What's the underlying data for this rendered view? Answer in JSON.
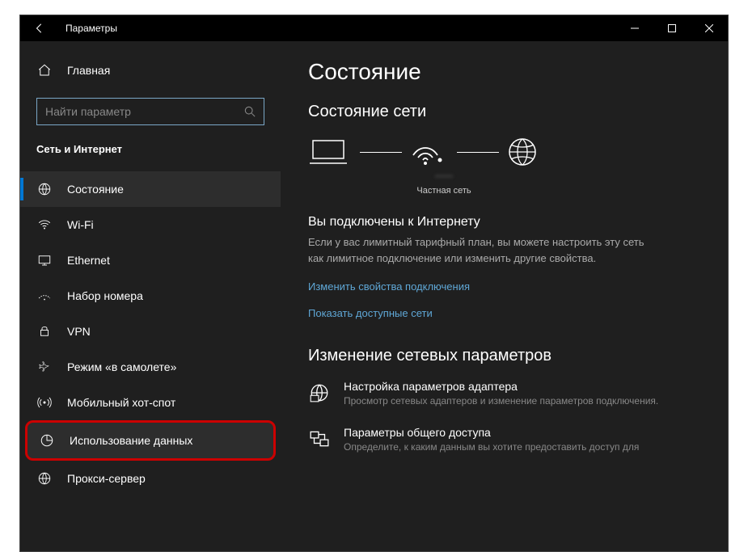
{
  "titlebar": {
    "title": "Параметры"
  },
  "sidebar": {
    "home": "Главная",
    "search_placeholder": "Найти параметр",
    "section": "Сеть и Интернет",
    "items": [
      {
        "label": "Состояние"
      },
      {
        "label": "Wi-Fi"
      },
      {
        "label": "Ethernet"
      },
      {
        "label": "Набор номера"
      },
      {
        "label": "VPN"
      },
      {
        "label": "Режим «в самолете»"
      },
      {
        "label": "Мобильный хот-спот"
      },
      {
        "label": "Использование данных"
      },
      {
        "label": "Прокси-сервер"
      }
    ]
  },
  "content": {
    "h1": "Состояние",
    "h2": "Состояние сети",
    "net_name": "——",
    "net_label": "Частная сеть",
    "status_title": "Вы подключены к Интернету",
    "status_desc": "Если у вас лимитный тарифный план, вы можете настроить эту сеть как лимитное подключение или изменить другие свойства.",
    "link1": "Изменить свойства подключения",
    "link2": "Показать доступные сети",
    "section2": "Изменение сетевых параметров",
    "opt1_title": "Настройка параметров адаптера",
    "opt1_desc": "Просмотр сетевых адаптеров и изменение параметров подключения.",
    "opt2_title": "Параметры общего доступа",
    "opt2_desc": "Определите, к каким данным вы хотите предоставить доступ для"
  }
}
